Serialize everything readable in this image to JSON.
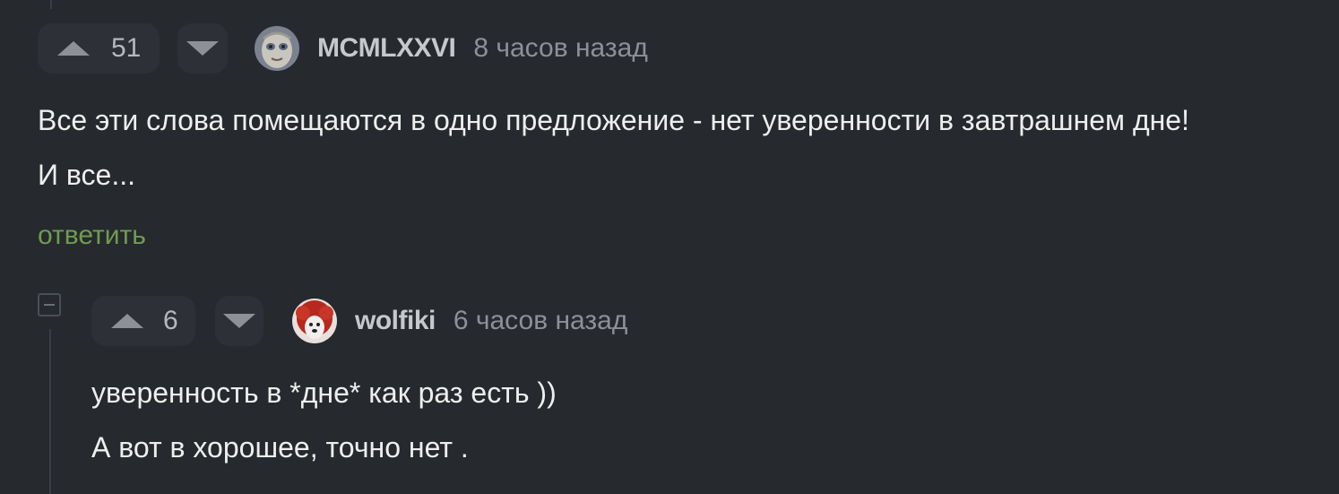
{
  "comments": [
    {
      "score": "51",
      "author": "MCMLXXVI",
      "time": "8 часов назад",
      "lines": [
        "Все эти слова помещаются в одно предложение - нет уверенности в завтрашнем дне!",
        "И все..."
      ],
      "reply_label": "ответить",
      "avatar_icon": "gollum-avatar"
    },
    {
      "score": "6",
      "author": "wolfiki",
      "time": "6 часов назад",
      "lines": [
        "уверенность в *дне* как раз есть ))",
        "А вот в хорошее, точно нет ."
      ],
      "avatar_icon": "dog-red-wig-avatar"
    }
  ],
  "colors": {
    "background": "#26292e",
    "reply_link": "#6f9c4f",
    "muted_text": "#8d9197"
  }
}
